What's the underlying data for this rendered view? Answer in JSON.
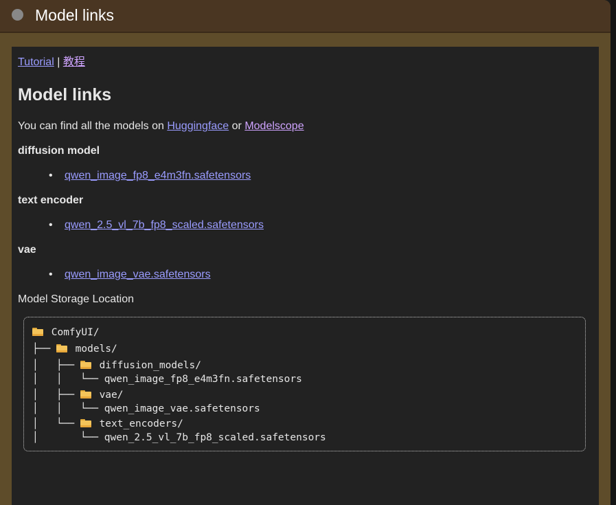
{
  "node": {
    "title": "Model links",
    "header_color": "#4a3622",
    "body_color": "#5e4c2a"
  },
  "links": {
    "tutorial": "Tutorial",
    "separator": "|",
    "chinese_tutorial": "教程"
  },
  "heading": "Model links",
  "intro": {
    "prefix": "You can find all the models on ",
    "huggingface": "Huggingface",
    "or": " or ",
    "modelscope": "Modelscope"
  },
  "sections": [
    {
      "title": "diffusion model",
      "file": "qwen_image_fp8_e4m3fn.safetensors"
    },
    {
      "title": "text encoder",
      "file": "qwen_2.5_vl_7b_fp8_scaled.safetensors"
    },
    {
      "title": "vae",
      "file": "qwen_image_vae.safetensors"
    }
  ],
  "storage_label": "Model Storage Location",
  "tree": [
    {
      "prefix": "",
      "folder": true,
      "text": "ComfyUI/"
    },
    {
      "prefix": "├── ",
      "folder": true,
      "text": "models/"
    },
    {
      "prefix": "│   ├── ",
      "folder": true,
      "text": "diffusion_models/"
    },
    {
      "prefix": "│   │   └── ",
      "folder": false,
      "text": "qwen_image_fp8_e4m3fn.safetensors"
    },
    {
      "prefix": "│   ├── ",
      "folder": true,
      "text": "vae/"
    },
    {
      "prefix": "│   │   └── ",
      "folder": false,
      "text": "qwen_image_vae.safetensors"
    },
    {
      "prefix": "│   └── ",
      "folder": true,
      "text": "text_encoders/"
    },
    {
      "prefix": "│       └── ",
      "folder": false,
      "text": "qwen_2.5_vl_7b_fp8_scaled.safetensors"
    }
  ]
}
